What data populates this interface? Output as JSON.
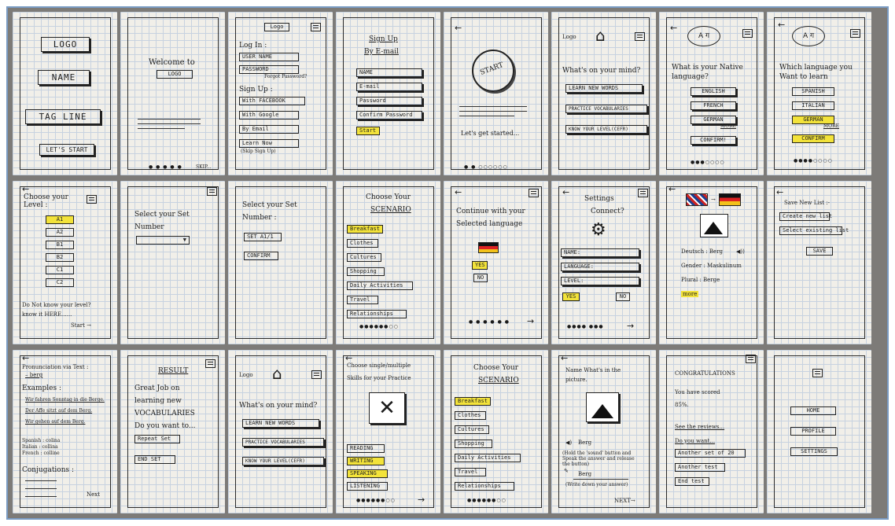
{
  "s1": {
    "logo": "LOGO",
    "name": "NAME",
    "tagline": "TAG LINE",
    "start": "LET'S START"
  },
  "s2": {
    "welcome": "Welcome to",
    "logo": "LOGO",
    "skip": "SKIP..."
  },
  "s3": {
    "logo": "Logo",
    "login": "Log In :",
    "username": "USER NAME",
    "password": "PASSWORD",
    "forgot": "Forgot Password?",
    "signup": "Sign Up :",
    "facebook": "With FACEBOOK",
    "google": "With Google",
    "email": "By Email",
    "learn": "Learn Now",
    "skip": "(Skip Sign Up)"
  },
  "s4": {
    "title": "Sign Up",
    "sub": "By E-mail",
    "name": "NAME",
    "email": "E-mail",
    "password": "Password",
    "confirm": "Confirm Password",
    "start": "Start"
  },
  "s5": {
    "start": "START",
    "lets": "Let's get started..."
  },
  "s6": {
    "logo": "Logo",
    "mind": "What's on your mind?",
    "learn": "LEARN NEW WORDS",
    "practice": "PRACTICE VOCABULARIES",
    "level": "KNOW YOUR LEVEL(CEFR)"
  },
  "s7": {
    "q1": "What is your Native",
    "q2": "language?",
    "english": "ENGLISH",
    "french": "FRENCH",
    "german": "GERMAN",
    "more": "MORE",
    "confirm": "CONFIRM!"
  },
  "s8": {
    "q1": "Which language you",
    "q2": "Want to learn",
    "spanish": "SPANISH",
    "italian": "ITALIAN",
    "german": "GERMAN",
    "more": "MORE",
    "confirm": "CONFIRM"
  },
  "s9": {
    "q1": "Choose your",
    "q2": "Level :",
    "levels": [
      "A1",
      "A2",
      "B1",
      "B2",
      "C1",
      "C2"
    ],
    "dont": "Do Not know your level?",
    "know": "know it HERE......",
    "start": "Start →"
  },
  "s10": {
    "q1": "Select your Set",
    "q2": "Number"
  },
  "s11": {
    "q1": "Select your Set",
    "q2": "Number :",
    "set": "SET A1/1",
    "confirm": "CONFIRM"
  },
  "s12": {
    "q1": "Choose Your",
    "q2": "SCENARIO",
    "items": [
      "Breakfast",
      "Clothes",
      "Cultures",
      "Shopping",
      "Daily Activities",
      "Travel",
      "Relationships"
    ]
  },
  "s13": {
    "q1": "Continue with your",
    "q2": "Selected language",
    "yes": "YES",
    "no": "NO"
  },
  "s14": {
    "q1": "Settings",
    "q2": "Connect?",
    "name": "NAME:",
    "language": "LANGUAGE:",
    "level": "LEVEL:",
    "yes": "YES",
    "no": "NO"
  },
  "s15": {
    "deutsch": "Deutsch : Berg",
    "gender": "Gender : Maskulinum",
    "plural": "Plural : Berge",
    "more": "more"
  },
  "s16": {
    "title": "Save New List :-",
    "create": "Create new list",
    "select": "Select existing list",
    "save": "SAVE"
  },
  "s17": {
    "pron": "Pronunciation via Text :",
    "word": "– berg",
    "examples": "Examples :",
    "ex": [
      "Wir fahren Sonntag in die Berge.",
      "Der Affe sitzt auf dem Berg.",
      "Wir gehen auf dem Berg."
    ],
    "spanish": "Spanish : colina",
    "italian": "Italian : collina",
    "french": "French : colline",
    "conj": "Conjugations :",
    "next": "Next"
  },
  "s18": {
    "result": "RESULT",
    "l1": "Great Job on",
    "l2": "learning new",
    "l3": "VOCABULARIES",
    "l4": "Do you want to...",
    "repeat": "Repeat Set",
    "end": "END SET"
  },
  "s19": {
    "logo": "Logo",
    "mind": "What's on your mind?",
    "learn": "LEARN NEW WORDS",
    "practice": "PRACTICE VOCABULARIES",
    "level": "KNOW YOUR LEVEL(CEFR)"
  },
  "s20": {
    "q1": "Choose single/multiple",
    "q2": "Skills for your Practice",
    "skills": [
      "READING",
      "WRITING",
      "SPEAKING",
      "LISTENING"
    ]
  },
  "s21": {
    "q1": "Choose Your",
    "q2": "SCENARIO",
    "items": [
      "Breakfast",
      "Clothes",
      "Cultures",
      "Shopping",
      "Daily Activities",
      "Travel",
      "Relationships"
    ]
  },
  "s22": {
    "q1": "Name What's in the",
    "q2": "picture.",
    "berg": "Berg",
    "h1": "(Hold the 'sound' button and",
    "h2": "Speak the answer and release",
    "h3": "the button)",
    "berg2": "Berg",
    "w": "(Write down your answer)",
    "next": "NEXT→"
  },
  "s23": {
    "congrats": "CONGRATULATIONS",
    "l1": "You have scored",
    "l2": "85%.",
    "reviews": "See the reviews...",
    "want": "Do you want...",
    "another20": "Another set of 20",
    "anotherTest": "Another test",
    "end": "End test"
  },
  "s24": {
    "home": "HOME",
    "profile": "PROFILE",
    "settings": "SETTINGS"
  },
  "colors": {
    "highlight": "#f3e33a",
    "paper": "#f1efe9",
    "gridline": "#c7d2e0",
    "border": "#7a9cc4"
  }
}
